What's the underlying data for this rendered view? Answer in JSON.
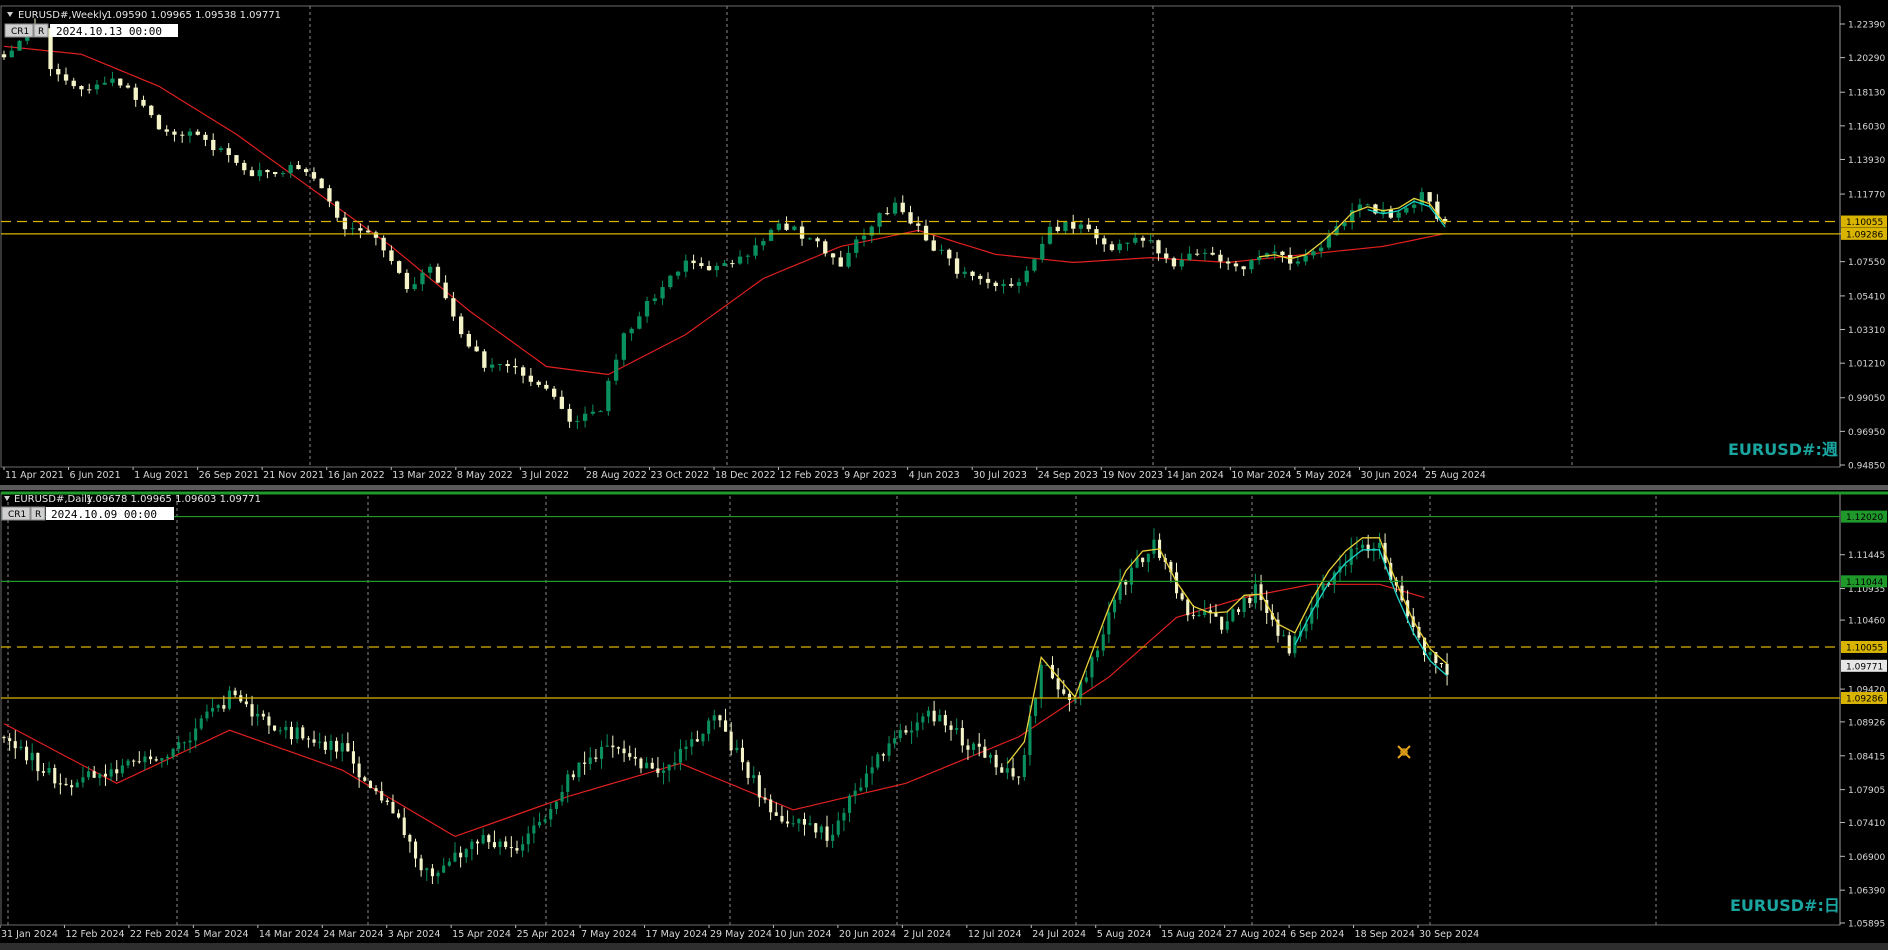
{
  "colors": {
    "background": "#000000",
    "grid": "#8a8a8a",
    "bull": "#0a8f5e",
    "bear": "#f4f4c8",
    "ma": "#e0201f",
    "zigzag_yellow": "#e8d23a",
    "zigzag_cyan": "#1ad6c8",
    "level_line": "#d8b400",
    "resistance_green": "#1f9a2a",
    "watermark": "#1aa5a0"
  },
  "icons": [
    "chevron-down-icon",
    "drawing-tool-icon"
  ],
  "charts": [
    {
      "panel": "weekly",
      "title": "EURUSD#,Weekly",
      "ohlc": "1.09590 1.09965 1.09538 1.09771",
      "btn_cr": "CR1",
      "btn_r": "R",
      "timestamp": "2024.10.13 00:00",
      "watermark": "EURUSD#:週",
      "price_ticks": [
        "1.22390",
        "1.20290",
        "1.18130",
        "1.16030",
        "1.13930",
        "1.11770",
        "1.09286",
        "1.07550",
        "1.05410",
        "1.03310",
        "1.01210",
        "0.99050",
        "0.96950",
        "0.94850"
      ],
      "price_badges": [
        "1.10055",
        "1.09286"
      ],
      "x_labels": [
        "11 Apr 2021",
        "6 Jun 2021",
        "1 Aug 2021",
        "26 Sep 2021",
        "21 Nov 2021",
        "16 Jan 2022",
        "13 Mar 2022",
        "8 May 2022",
        "3 Jul 2022",
        "28 Aug 2022",
        "23 Oct 2022",
        "18 Dec 2022",
        "12 Feb 2023",
        "9 Apr 2023",
        "4 Jun 2023",
        "30 Jul 2023",
        "24 Sep 2023",
        "19 Nov 2023",
        "14 Jan 2024",
        "10 Mar 2024",
        "5 May 2024",
        "30 Jun 2024",
        "25 Aug 2024"
      ]
    },
    {
      "panel": "daily",
      "title": "EURUSD#,Daily",
      "ohlc": "1.09678 1.09965 1.09603 1.09771",
      "btn_cr": "CR1",
      "btn_r": "R",
      "timestamp": "2024.10.09 00:00",
      "watermark": "EURUSD#:日",
      "price_ticks": [
        "1.11445",
        "1.10935",
        "1.10460",
        "1.09420",
        "1.08926",
        "1.08415",
        "1.07905",
        "1.07410",
        "1.06900",
        "1.06390",
        "1.05895"
      ],
      "price_badges": [
        "1.12020",
        "1.11044",
        "1.10055",
        "1.09771",
        "1.09286"
      ],
      "x_labels": [
        "31 Jan 2024",
        "12 Feb 2024",
        "22 Feb 2024",
        "5 Mar 2024",
        "14 Mar 2024",
        "24 Mar 2024",
        "3 Apr 2024",
        "15 Apr 2024",
        "25 Apr 2024",
        "7 May 2024",
        "17 May 2024",
        "29 May 2024",
        "10 Jun 2024",
        "20 Jun 2024",
        "2 Jul 2024",
        "12 Jul 2024",
        "24 Jul 2024",
        "5 Aug 2024",
        "15 Aug 2024",
        "27 Aug 2024",
        "6 Sep 2024",
        "18 Sep 2024",
        "30 Sep 2024"
      ]
    }
  ],
  "chart_data": [
    {
      "type": "candlestick",
      "title": "EURUSD#,Weekly",
      "ylim": [
        0.9485,
        1.2339
      ],
      "levels": [
        1.10055,
        1.09286
      ],
      "series": [
        {
          "name": "price",
          "close_path": [
            [
              0,
              1.205
            ],
            [
              3,
              1.22
            ],
            [
              5,
              1.222
            ],
            [
              6,
              1.195
            ],
            [
              10,
              1.185
            ],
            [
              14,
              1.188
            ],
            [
              17,
              1.178
            ],
            [
              20,
              1.16
            ],
            [
              24,
              1.155
            ],
            [
              28,
              1.145
            ],
            [
              31,
              1.13
            ],
            [
              35,
              1.13
            ],
            [
              38,
              1.135
            ],
            [
              41,
              1.12
            ],
            [
              44,
              1.095
            ],
            [
              48,
              1.09
            ],
            [
              52,
              1.06
            ],
            [
              55,
              1.07
            ],
            [
              58,
              1.04
            ],
            [
              62,
              1.01
            ],
            [
              66,
              1.01
            ],
            [
              70,
              0.995
            ],
            [
              73,
              0.975
            ],
            [
              77,
              0.985
            ],
            [
              80,
              1.03
            ],
            [
              84,
              1.055
            ],
            [
              88,
              1.075
            ],
            [
              92,
              1.07
            ],
            [
              96,
              1.08
            ],
            [
              100,
              1.1
            ],
            [
              104,
              1.09
            ],
            [
              108,
              1.075
            ],
            [
              112,
              1.1
            ],
            [
              115,
              1.11
            ],
            [
              119,
              1.09
            ],
            [
              123,
              1.07
            ],
            [
              127,
              1.06
            ],
            [
              131,
              1.06
            ],
            [
              135,
              1.095
            ],
            [
              139,
              1.1
            ],
            [
              143,
              1.085
            ],
            [
              147,
              1.09
            ],
            [
              151,
              1.075
            ],
            [
              155,
              1.08
            ],
            [
              159,
              1.07
            ],
            [
              163,
              1.08
            ],
            [
              167,
              1.075
            ],
            [
              171,
              1.09
            ],
            [
              175,
              1.11
            ],
            [
              179,
              1.105
            ],
            [
              183,
              1.117
            ],
            [
              186,
              1.098
            ]
          ]
        },
        {
          "name": "ma",
          "close_path": [
            [
              0,
              1.21
            ],
            [
              10,
              1.205
            ],
            [
              20,
              1.185
            ],
            [
              30,
              1.155
            ],
            [
              40,
              1.12
            ],
            [
              50,
              1.085
            ],
            [
              60,
              1.045
            ],
            [
              70,
              1.01
            ],
            [
              78,
              1.005
            ],
            [
              88,
              1.03
            ],
            [
              98,
              1.065
            ],
            [
              108,
              1.085
            ],
            [
              118,
              1.095
            ],
            [
              128,
              1.08
            ],
            [
              138,
              1.075
            ],
            [
              148,
              1.078
            ],
            [
              158,
              1.075
            ],
            [
              168,
              1.08
            ],
            [
              178,
              1.085
            ],
            [
              186,
              1.093
            ]
          ]
        }
      ]
    },
    {
      "type": "candlestick",
      "title": "EURUSD#,Daily",
      "ylim": [
        1.05895,
        1.123
      ],
      "levels": [
        1.1202,
        1.11044,
        1.10055,
        1.09286
      ],
      "series": [
        {
          "name": "price",
          "close_path": [
            [
              0,
              1.087
            ],
            [
              10,
              1.08
            ],
            [
              20,
              1.082
            ],
            [
              30,
              1.085
            ],
            [
              40,
              1.093
            ],
            [
              50,
              1.088
            ],
            [
              60,
              1.085
            ],
            [
              68,
              1.077
            ],
            [
              76,
              1.065
            ],
            [
              84,
              1.072
            ],
            [
              92,
              1.07
            ],
            [
              100,
              1.081
            ],
            [
              108,
              1.086
            ],
            [
              116,
              1.081
            ],
            [
              126,
              1.09
            ],
            [
              136,
              1.076
            ],
            [
              146,
              1.072
            ],
            [
              156,
              1.085
            ],
            [
              164,
              1.091
            ],
            [
              172,
              1.085
            ],
            [
              180,
              1.081
            ],
            [
              184,
              1.098
            ],
            [
              190,
              1.092
            ],
            [
              198,
              1.11
            ],
            [
              204,
              1.116
            ],
            [
              210,
              1.106
            ],
            [
              216,
              1.104
            ],
            [
              222,
              1.109
            ],
            [
              228,
              1.1
            ],
            [
              234,
              1.11
            ],
            [
              240,
              1.116
            ],
            [
              244,
              1.116
            ],
            [
              248,
              1.107
            ],
            [
              252,
              1.1
            ],
            [
              256,
              1.097
            ]
          ]
        },
        {
          "name": "ma",
          "close_path": [
            [
              0,
              1.089
            ],
            [
              20,
              1.08
            ],
            [
              40,
              1.088
            ],
            [
              60,
              1.082
            ],
            [
              80,
              1.072
            ],
            [
              100,
              1.078
            ],
            [
              120,
              1.083
            ],
            [
              140,
              1.076
            ],
            [
              160,
              1.08
            ],
            [
              180,
              1.087
            ],
            [
              196,
              1.096
            ],
            [
              208,
              1.105
            ],
            [
              220,
              1.108
            ],
            [
              232,
              1.11
            ],
            [
              244,
              1.11
            ],
            [
              252,
              1.108
            ]
          ]
        }
      ]
    }
  ]
}
